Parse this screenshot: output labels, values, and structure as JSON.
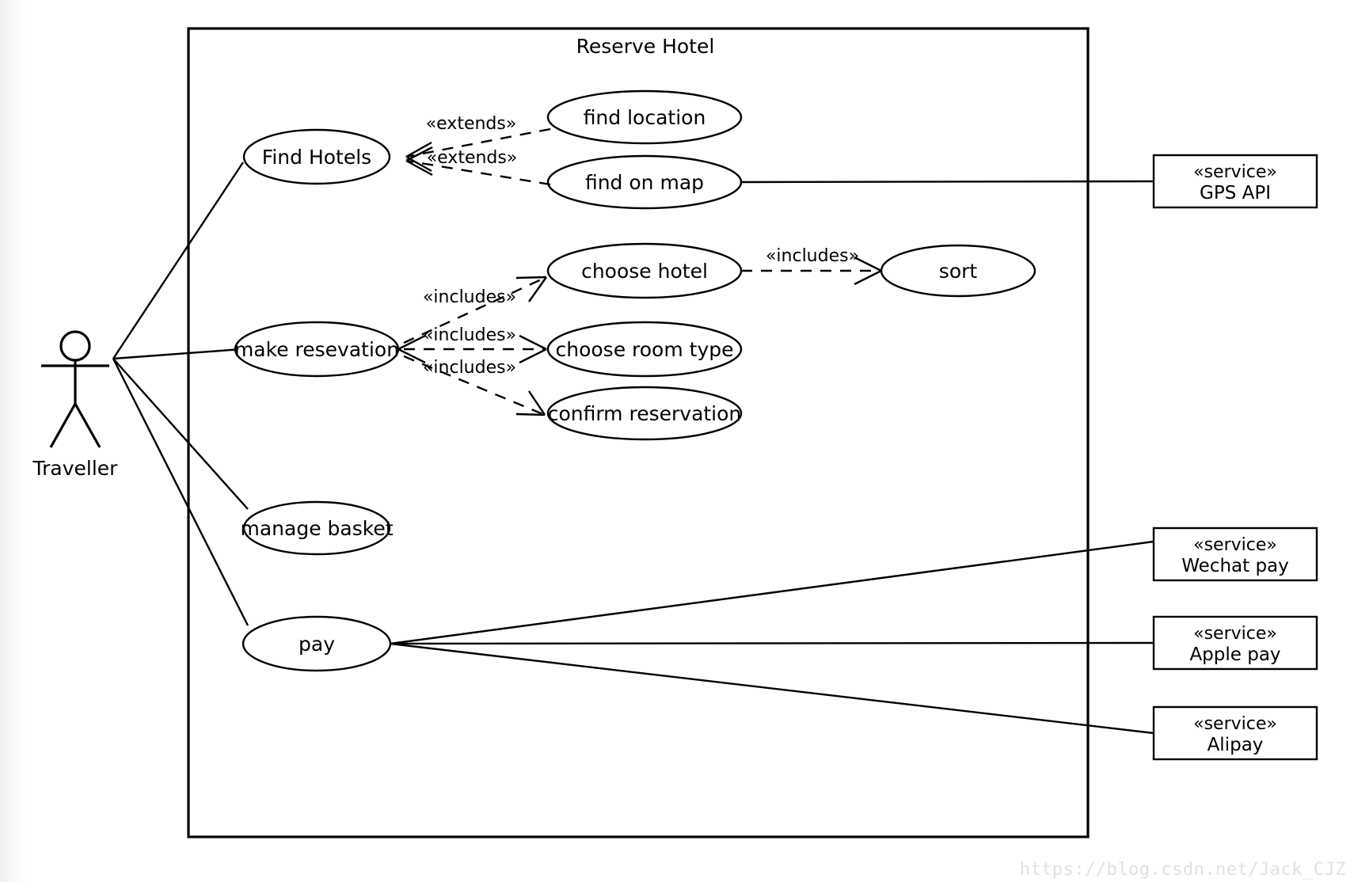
{
  "diagram": {
    "type": "uml-use-case-diagram",
    "system_boundary_title": "Reserve Hotel",
    "watermark": "https://blog.csdn.net/Jack_CJZ"
  },
  "actors": [
    {
      "id": "traveller",
      "label": "Traveller"
    }
  ],
  "use_cases": [
    {
      "id": "find_hotels",
      "label": "Find Hotels"
    },
    {
      "id": "find_location",
      "label": "find location"
    },
    {
      "id": "find_on_map",
      "label": "find on map"
    },
    {
      "id": "choose_hotel",
      "label": "choose hotel"
    },
    {
      "id": "sort",
      "label": "sort"
    },
    {
      "id": "make_reservation",
      "label": "make resevation"
    },
    {
      "id": "choose_room_type",
      "label": "choose room type"
    },
    {
      "id": "confirm_reservation",
      "label": "confirm reservation"
    },
    {
      "id": "manage_basket",
      "label": "manage basket"
    },
    {
      "id": "pay",
      "label": "pay"
    }
  ],
  "services": [
    {
      "id": "gps_api",
      "stereotype": "«service»",
      "name": "GPS API"
    },
    {
      "id": "wechat_pay",
      "stereotype": "«service»",
      "name": "Wechat pay"
    },
    {
      "id": "apple_pay",
      "stereotype": "«service»",
      "name": "Apple pay"
    },
    {
      "id": "alipay",
      "stereotype": "«service»",
      "name": "Alipay"
    }
  ],
  "relationship_labels": {
    "extends_find_location": "«extends»",
    "extends_find_on_map": "«extends»",
    "includes_choose_hotel": "«includes»",
    "includes_choose_room_type": "«includes»",
    "includes_confirm_reservation": "«includes»",
    "includes_sort": "«includes»"
  },
  "associations": [
    {
      "from": "traveller",
      "to": "find_hotels"
    },
    {
      "from": "traveller",
      "to": "make_reservation"
    },
    {
      "from": "traveller",
      "to": "manage_basket"
    },
    {
      "from": "traveller",
      "to": "pay"
    },
    {
      "from": "find_on_map",
      "to": "gps_api"
    },
    {
      "from": "pay",
      "to": "wechat_pay"
    },
    {
      "from": "pay",
      "to": "apple_pay"
    },
    {
      "from": "pay",
      "to": "alipay"
    }
  ],
  "colors": {
    "stroke": "#000000",
    "background": "#ffffff",
    "watermark": "#e3e0e0"
  }
}
